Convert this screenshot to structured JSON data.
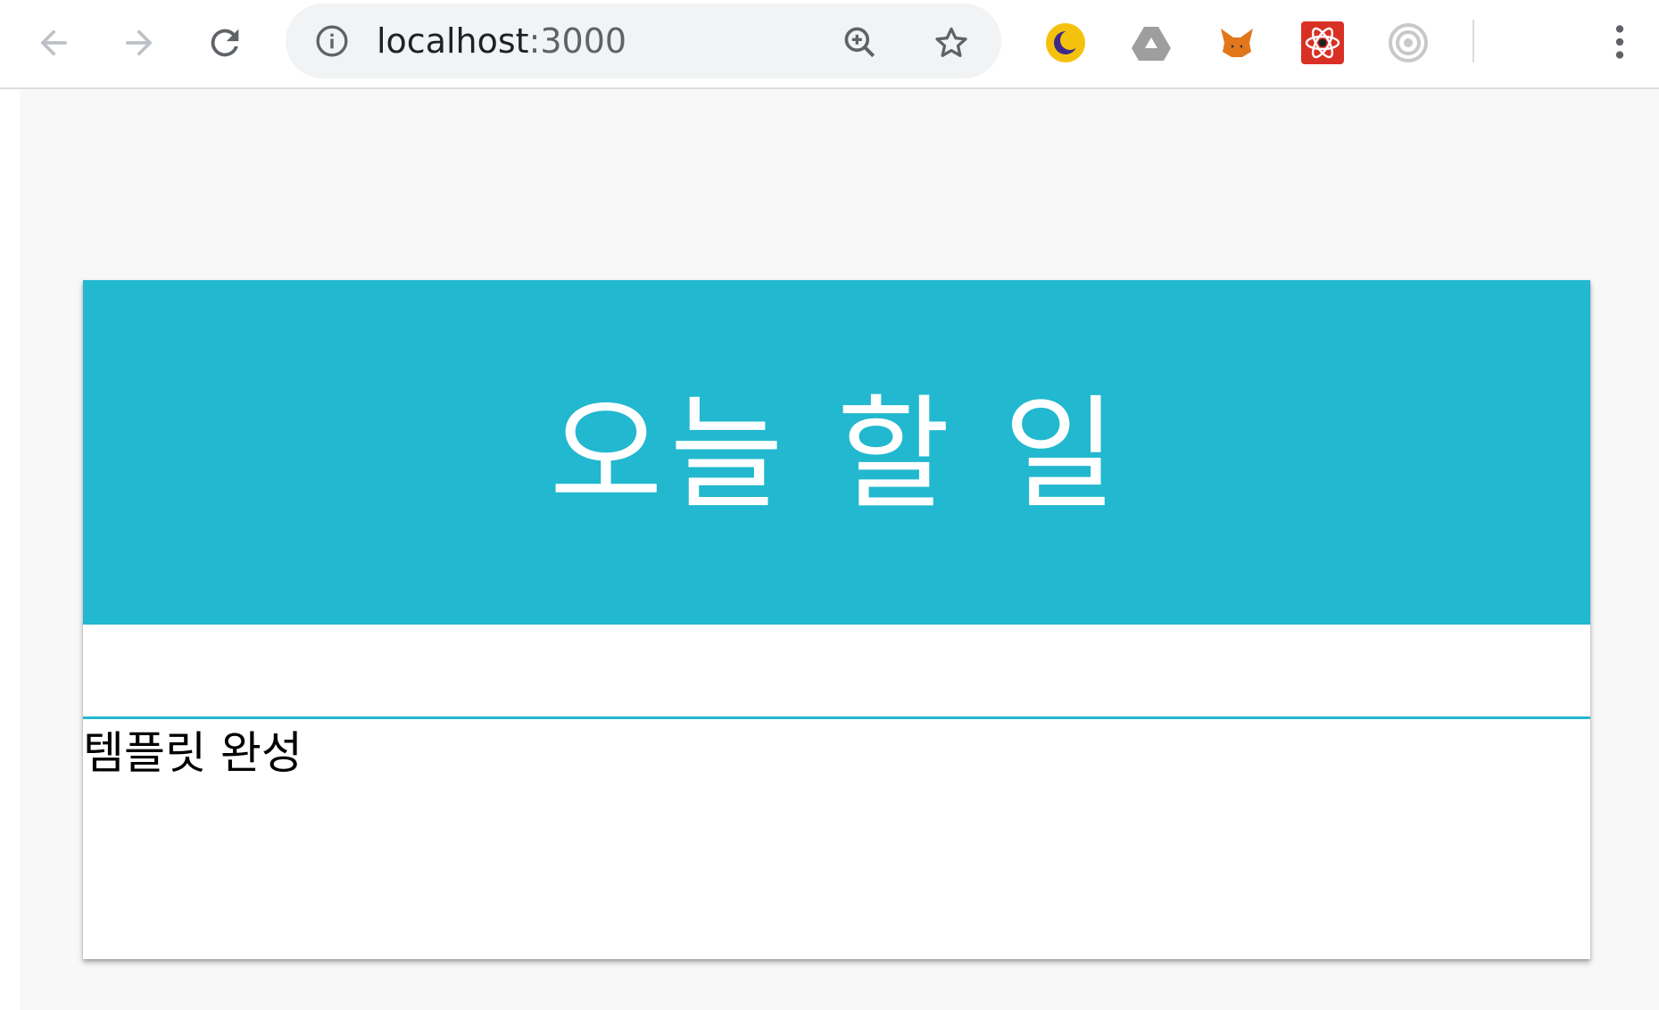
{
  "browser": {
    "url_host": "localhost",
    "url_port": ":3000",
    "icons": {
      "back": "back-arrow-icon",
      "forward": "forward-arrow-icon",
      "reload": "reload-icon",
      "info": "info-icon",
      "zoom": "zoom-in-icon",
      "bookmark": "star-icon",
      "menu": "kebab-menu-icon"
    },
    "extensions": [
      {
        "name": "night-mode-extension-icon",
        "color": "#f4c20d"
      },
      {
        "name": "google-drive-extension-icon",
        "color": "#9e9e9e"
      },
      {
        "name": "metamask-extension-icon",
        "color": "#e2761b"
      },
      {
        "name": "react-devtools-extension-icon",
        "color": "#d93025"
      },
      {
        "name": "target-extension-icon",
        "color": "#bdbdbd"
      }
    ]
  },
  "app": {
    "title": "오늘 할 일",
    "accent_color": "#22b8cf",
    "todos": [
      {
        "text": "템플릿 완성"
      }
    ]
  }
}
